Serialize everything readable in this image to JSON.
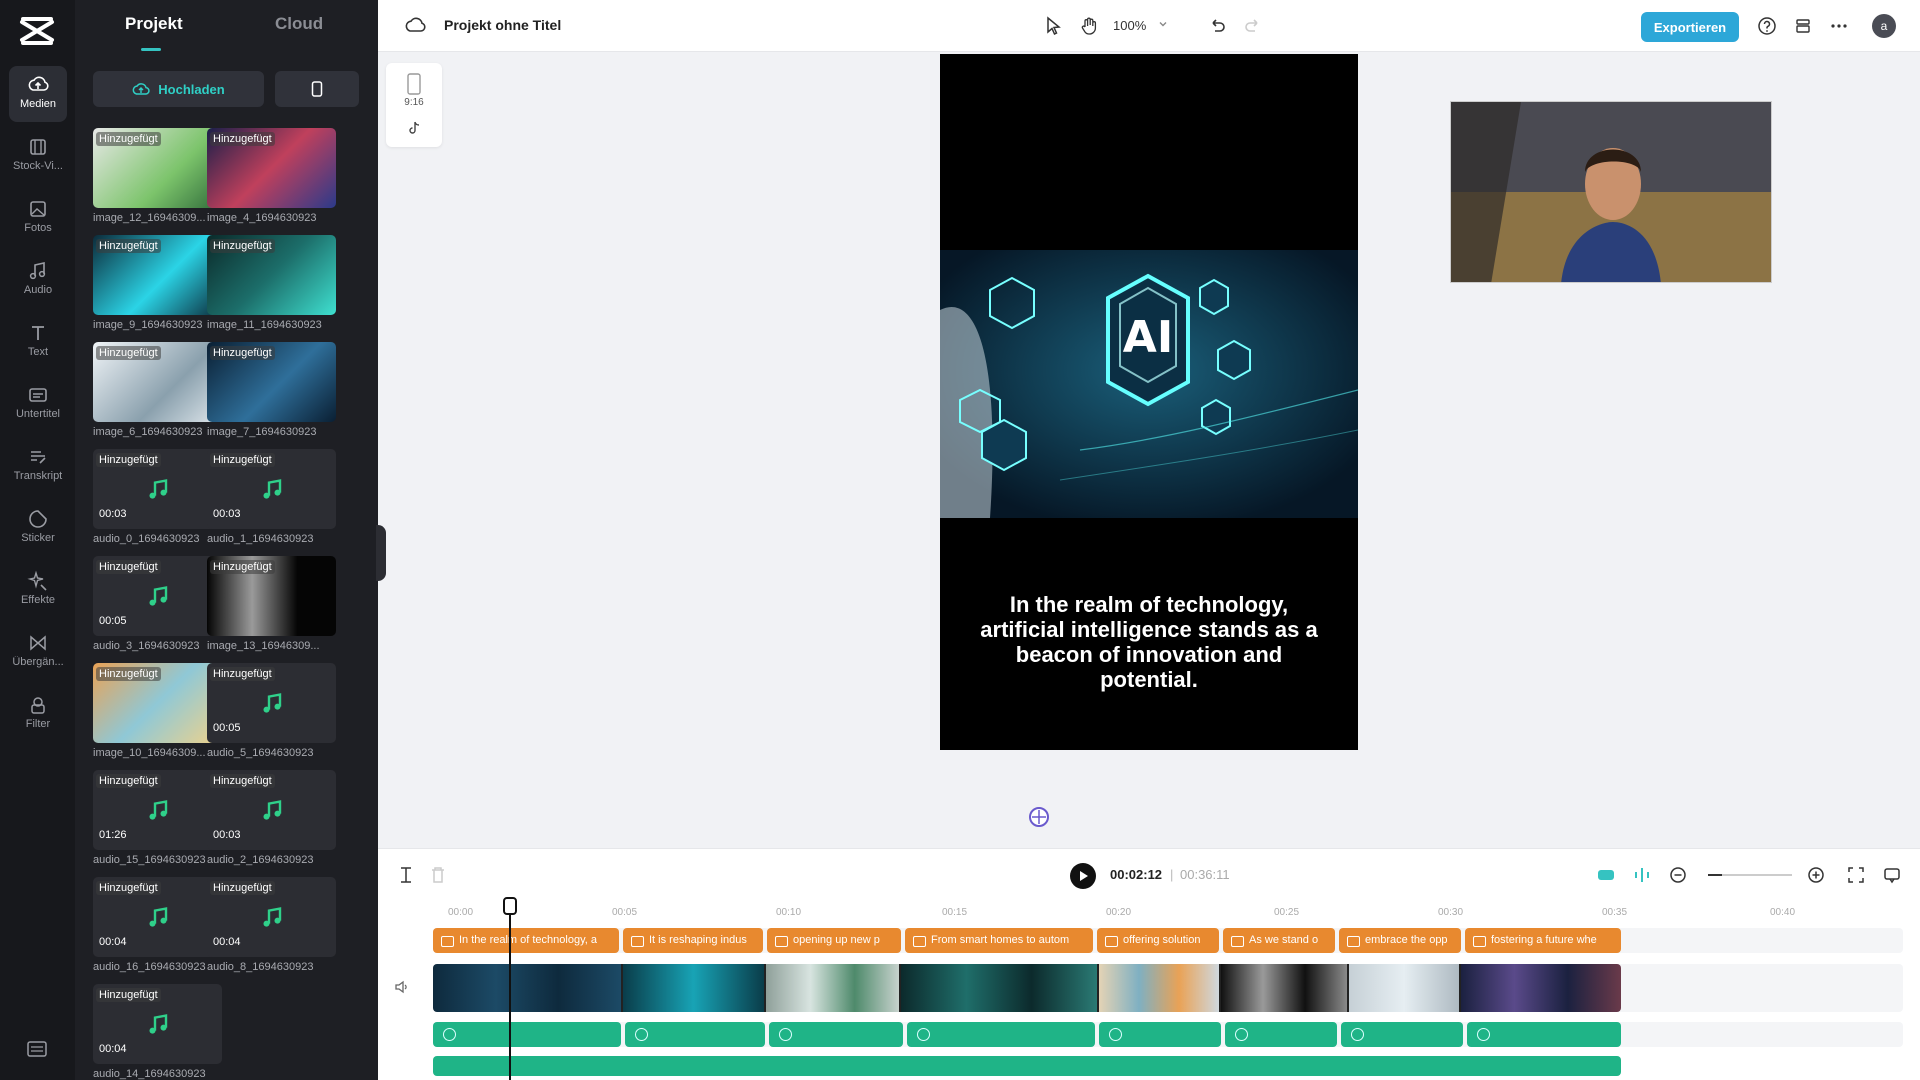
{
  "sidebar": {
    "items": [
      {
        "label": "Medien",
        "icon": "cloud-upload-icon"
      },
      {
        "label": "Stock-Vi...",
        "icon": "film-icon"
      },
      {
        "label": "Fotos",
        "icon": "image-icon"
      },
      {
        "label": "Audio",
        "icon": "music-icon"
      },
      {
        "label": "Text",
        "icon": "text-icon"
      },
      {
        "label": "Untertitel",
        "icon": "subtitles-icon"
      },
      {
        "label": "Transkript",
        "icon": "transcript-icon"
      },
      {
        "label": "Sticker",
        "icon": "sticker-icon"
      },
      {
        "label": "Effekte",
        "icon": "effects-icon"
      },
      {
        "label": "Übergän...",
        "icon": "transition-icon"
      },
      {
        "label": "Filter",
        "icon": "filter-icon"
      }
    ]
  },
  "media_panel": {
    "tabs": [
      "Projekt",
      "Cloud"
    ],
    "upload_label": "Hochladen",
    "items": [
      {
        "badge": "Hinzugefügt",
        "name": "image_12_16946309...",
        "type": "image",
        "duration": ""
      },
      {
        "badge": "Hinzugefügt",
        "name": "image_4_1694630923",
        "type": "image",
        "duration": ""
      },
      {
        "badge": "Hinzugefügt",
        "name": "image_9_1694630923",
        "type": "image",
        "duration": ""
      },
      {
        "badge": "Hinzugefügt",
        "name": "image_11_1694630923",
        "type": "image",
        "duration": ""
      },
      {
        "badge": "Hinzugefügt",
        "name": "image_6_1694630923",
        "type": "image",
        "duration": ""
      },
      {
        "badge": "Hinzugefügt",
        "name": "image_7_1694630923",
        "type": "image",
        "duration": ""
      },
      {
        "badge": "Hinzugefügt",
        "name": "audio_0_1694630923",
        "type": "audio",
        "duration": "00:03"
      },
      {
        "badge": "Hinzugefügt",
        "name": "audio_1_1694630923",
        "type": "audio",
        "duration": "00:03"
      },
      {
        "badge": "Hinzugefügt",
        "name": "audio_3_1694630923",
        "type": "audio",
        "duration": "00:05"
      },
      {
        "badge": "Hinzugefügt",
        "name": "image_13_16946309...",
        "type": "image",
        "duration": ""
      },
      {
        "badge": "Hinzugefügt",
        "name": "image_10_16946309...",
        "type": "image",
        "duration": ""
      },
      {
        "badge": "Hinzugefügt",
        "name": "audio_5_1694630923",
        "type": "audio",
        "duration": "00:05"
      },
      {
        "badge": "Hinzugefügt",
        "name": "audio_15_1694630923",
        "type": "audio",
        "duration": "01:26"
      },
      {
        "badge": "Hinzugefügt",
        "name": "audio_2_1694630923",
        "type": "audio",
        "duration": "00:03"
      },
      {
        "badge": "Hinzugefügt",
        "name": "audio_16_1694630923",
        "type": "audio",
        "duration": "00:04"
      },
      {
        "badge": "Hinzugefügt",
        "name": "audio_8_1694630923",
        "type": "audio",
        "duration": "00:04"
      },
      {
        "badge": "Hinzugefügt",
        "name": "audio_14_1694630923",
        "type": "audio",
        "duration": "00:04"
      }
    ]
  },
  "topbar": {
    "project_title": "Projekt ohne Titel",
    "zoom": "100%",
    "export_label": "Exportieren",
    "avatar_initial": "a"
  },
  "canvas": {
    "ratio_label": "9:16",
    "image_text": "AI",
    "caption": "In the realm of technology, artificial intelligence stands as a beacon of innovation and potential."
  },
  "timeline": {
    "current_time": "00:02:12",
    "separator": "|",
    "total_time": "00:36:11",
    "ruler": [
      "00:00",
      "00:05",
      "00:10",
      "00:15",
      "00:20",
      "00:25",
      "00:30",
      "00:35",
      "00:40"
    ],
    "text_clips": [
      "In the realm of technology, a",
      "It is reshaping indus",
      "opening up new p",
      "From smart homes to autom",
      "offering solution",
      "As we stand o",
      "embrace the opp",
      "fostering a future whe"
    ]
  },
  "colors": {
    "accent": "#35c3c1",
    "export": "#2da7d8",
    "text_track": "#e8892f",
    "audio_track": "#1fb487",
    "panel_bg": "#1e1f24"
  }
}
